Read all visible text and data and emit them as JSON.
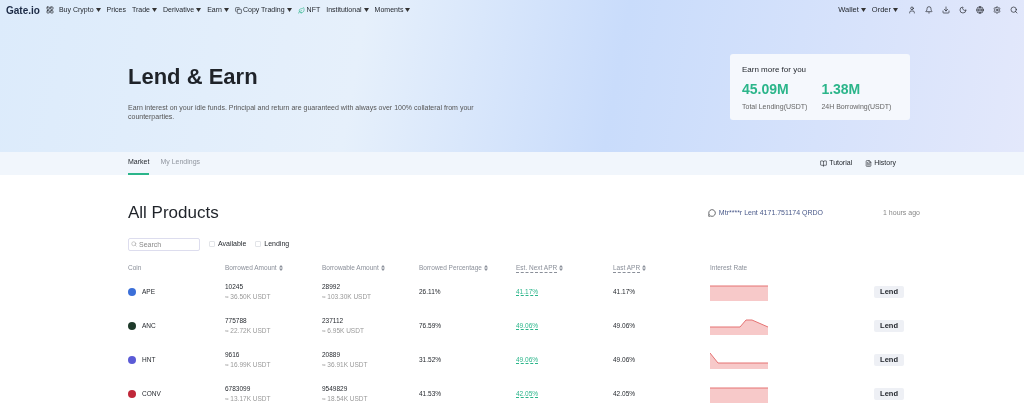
{
  "nav": {
    "logo": "Gate.io",
    "items": [
      {
        "label": "Buy Crypto",
        "caret": true
      },
      {
        "label": "Prices",
        "caret": false
      },
      {
        "label": "Trade",
        "caret": true
      },
      {
        "label": "Derivative",
        "caret": true
      },
      {
        "label": "Earn",
        "caret": true
      },
      {
        "label": "Copy Trading",
        "caret": true,
        "kind": "copy"
      },
      {
        "label": "NFT",
        "caret": false,
        "kind": "nft"
      },
      {
        "label": "Institutional",
        "caret": true
      },
      {
        "label": "Moments",
        "caret": true
      }
    ],
    "right_items": [
      {
        "label": "Wallet"
      },
      {
        "label": "Order"
      }
    ]
  },
  "hero": {
    "title": "Lend & Earn",
    "description": "Earn interest on your idle funds. Principal and return are guaranteed with always over 100% collateral from your counterparties.",
    "card": {
      "title": "Earn more for you",
      "stats": [
        {
          "value": "45.09M",
          "label": "Total Lending(USDT)"
        },
        {
          "value": "1.38M",
          "label": "24H Borrowing(USDT)"
        }
      ]
    }
  },
  "tabs": [
    {
      "label": "Market",
      "selected": true
    },
    {
      "label": "My Lendings",
      "selected": false
    }
  ],
  "links": [
    {
      "label": "Tutorial",
      "kind": "tutorial"
    },
    {
      "label": "History",
      "kind": "history"
    }
  ],
  "section": {
    "title": "All Products",
    "ticker": "Mtr****r Lent 4171.751174 QRDO",
    "ticker_time": "1 hours ago"
  },
  "filters": {
    "search_placeholder": "Search",
    "options": [
      {
        "label": "Available",
        "checked": false
      },
      {
        "label": "Lending",
        "checked": false
      }
    ]
  },
  "table": {
    "columns": [
      {
        "label": "Coin",
        "sortable": false,
        "dashed": false
      },
      {
        "label": "Borrowed Amount",
        "sortable": true,
        "dashed": false
      },
      {
        "label": "Borrowable Amount",
        "sortable": true,
        "dashed": false
      },
      {
        "label": "Borrowed Percentage",
        "sortable": true,
        "dashed": false
      },
      {
        "label": "Est. Next APR",
        "sortable": true,
        "dashed": true
      },
      {
        "label": "Last APR",
        "sortable": true,
        "dashed": true
      },
      {
        "label": "Interest Rate",
        "sortable": false,
        "dashed": false
      }
    ],
    "rows": [
      {
        "coin": "APE",
        "color": "#3b6fd8",
        "borrowed": "10245",
        "borrowed_usdt": "≈ 36.50K USDT",
        "borrowable": "28992",
        "borrowable_usdt": "≈ 103.30K USDT",
        "percentage": "26.11%",
        "est_apr": "41.17%",
        "last_apr": "41.17%",
        "action": "Lend"
      },
      {
        "coin": "ANC",
        "color": "#1e3a2a",
        "borrowed": "775788",
        "borrowed_usdt": "≈ 22.72K USDT",
        "borrowable": "237112",
        "borrowable_usdt": "≈ 6.95K USDT",
        "percentage": "76.59%",
        "est_apr": "49.06%",
        "last_apr": "49.06%",
        "action": "Lend"
      },
      {
        "coin": "HNT",
        "color": "#5b5bd6",
        "borrowed": "9616",
        "borrowed_usdt": "≈ 16.99K USDT",
        "borrowable": "20889",
        "borrowable_usdt": "≈ 36.91K USDT",
        "percentage": "31.52%",
        "est_apr": "49.06%",
        "last_apr": "49.06%",
        "action": "Lend"
      },
      {
        "coin": "CONV",
        "color": "#c0283a",
        "borrowed": "6783099",
        "borrowed_usdt": "≈ 13.17K USDT",
        "borrowable": "9549829",
        "borrowable_usdt": "≈ 18.54K USDT",
        "percentage": "41.53%",
        "est_apr": "42.05%",
        "last_apr": "42.05%",
        "action": "Lend"
      }
    ]
  }
}
